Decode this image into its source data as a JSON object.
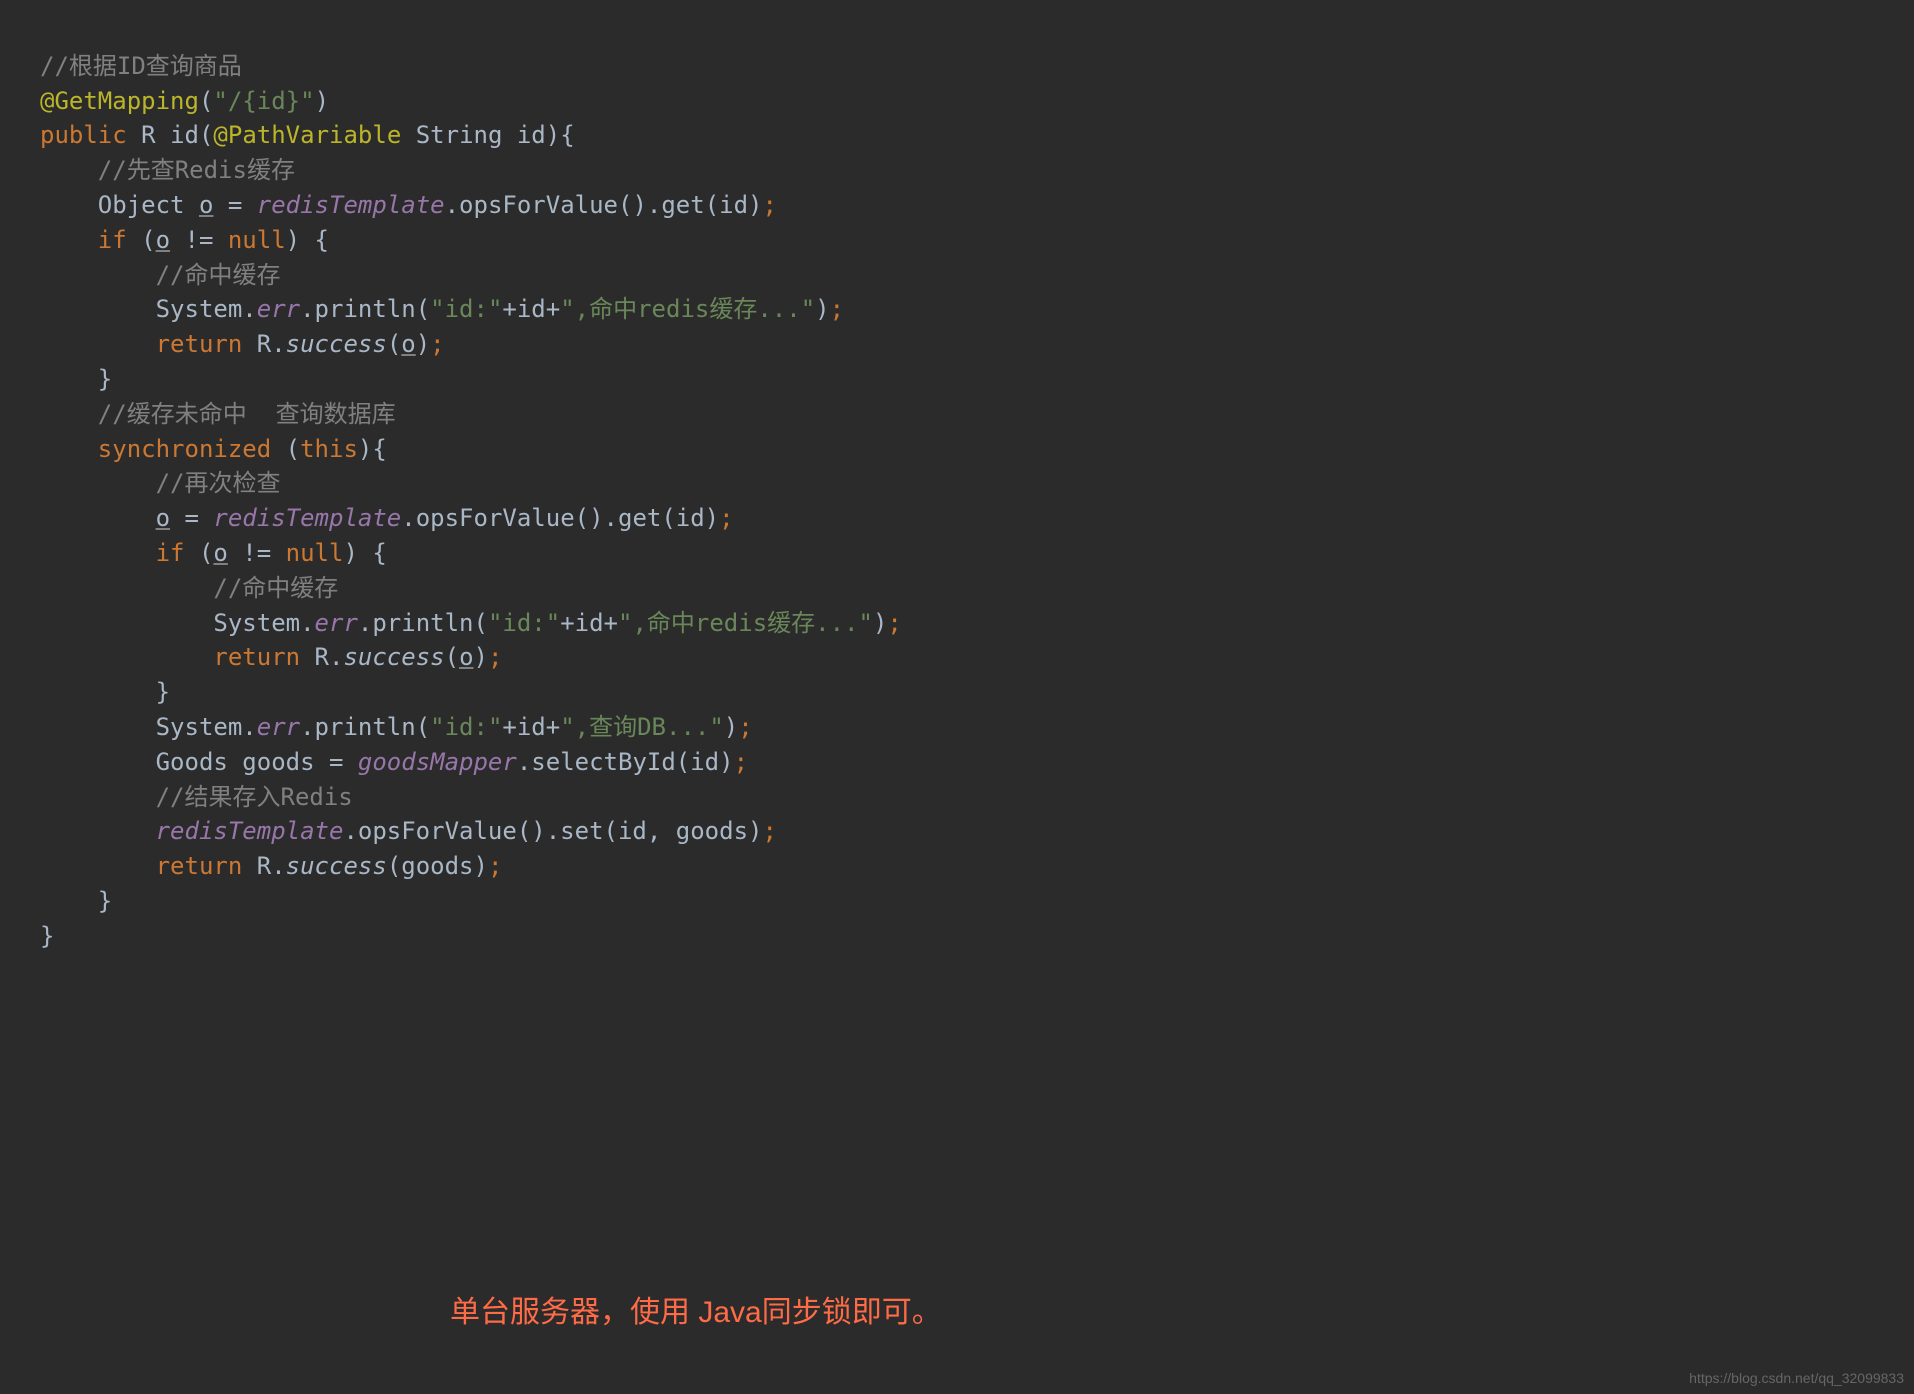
{
  "code": {
    "line1_comment": "//根据ID查询商品",
    "line2_annotation": "@GetMapping",
    "line2_paren_open": "(",
    "line2_string": "\"/{id}\"",
    "line2_paren_close": ")",
    "line3_public": "public",
    "line3_type": " R ",
    "line3_method": "id",
    "line3_paren_open": "(",
    "line3_anno": "@PathVariable",
    "line3_param_type": " String ",
    "line3_param_name": "id",
    "line3_paren_close": ")",
    "line3_brace": "{",
    "line4_comment": "//先查Redis缓存",
    "line5_type": "Object ",
    "line5_var": "o",
    "line5_eq": " = ",
    "line5_field": "redisTemplate",
    "line5_call": ".opsForValue().get(id)",
    "line5_semi": ";",
    "line6_if": "if",
    "line6_cond_open": " (",
    "line6_var": "o",
    "line6_op": " != ",
    "line6_null": "null",
    "line6_cond_close": ") {",
    "line7_comment": "//命中缓存",
    "line8_sys": "System.",
    "line8_err": "err",
    "line8_print": ".println(",
    "line8_str1": "\"id:\"",
    "line8_plus1": "+id+",
    "line8_str2": "\",命中redis缓存...\"",
    "line8_close": ")",
    "line8_semi": ";",
    "line9_return": "return",
    "line9_r": " R.",
    "line9_success": "success",
    "line9_open": "(",
    "line9_var": "o",
    "line9_close": ")",
    "line9_semi": ";",
    "line10_brace": "}",
    "line11_comment": "//缓存未命中  查询数据库",
    "line12_sync": "synchronized",
    "line12_open": " (",
    "line12_this": "this",
    "line12_close": "){",
    "line13_comment": "//再次检查",
    "line14_var": "o",
    "line14_eq": " = ",
    "line14_field": "redisTemplate",
    "line14_call": ".opsForValue().get(id)",
    "line14_semi": ";",
    "line15_if": "if",
    "line15_cond_open": " (",
    "line15_var": "o",
    "line15_op": " != ",
    "line15_null": "null",
    "line15_cond_close": ") {",
    "line16_comment": "//命中缓存",
    "line17_sys": "System.",
    "line17_err": "err",
    "line17_print": ".println(",
    "line17_str1": "\"id:\"",
    "line17_plus1": "+id+",
    "line17_str2": "\",命中redis缓存...\"",
    "line17_close": ")",
    "line17_semi": ";",
    "line18_return": "return",
    "line18_r": " R.",
    "line18_success": "success",
    "line18_open": "(",
    "line18_var": "o",
    "line18_close": ")",
    "line18_semi": ";",
    "line19_brace": "}",
    "line20_sys": "System.",
    "line20_err": "err",
    "line20_print": ".println(",
    "line20_str1": "\"id:\"",
    "line20_plus1": "+id+",
    "line20_str2": "\",查询DB...\"",
    "line20_close": ")",
    "line20_semi": ";",
    "line21_type": "Goods goods = ",
    "line21_field": "goodsMapper",
    "line21_call": ".selectById(id)",
    "line21_semi": ";",
    "line22_comment": "//结果存入Redis",
    "line23_field": "redisTemplate",
    "line23_call": ".opsForValue().set(id, goods)",
    "line23_semi": ";",
    "line24_return": "return",
    "line24_r": " R.",
    "line24_success": "success",
    "line24_open": "(goods)",
    "line24_semi": ";",
    "line25_brace": "}",
    "line26_brace": "}"
  },
  "annotation": "单台服务器，使用 Java同步锁即可。",
  "watermark": "https://blog.csdn.net/qq_32099833"
}
